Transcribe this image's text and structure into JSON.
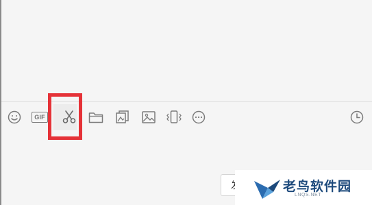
{
  "toolbar": {
    "items": [
      {
        "name": "emoji",
        "icon": "smiley-icon"
      },
      {
        "name": "gif",
        "icon": "gif-icon",
        "label": "GIF"
      },
      {
        "name": "screenshot",
        "icon": "scissors-icon",
        "highlighted": true
      },
      {
        "name": "file",
        "icon": "folder-icon"
      },
      {
        "name": "favorites",
        "icon": "album-icon"
      },
      {
        "name": "image",
        "icon": "image-icon"
      },
      {
        "name": "vibrate",
        "icon": "phone-shake-icon"
      },
      {
        "name": "more",
        "icon": "more-dots-icon"
      },
      {
        "name": "history",
        "icon": "clock-icon"
      }
    ]
  },
  "send": {
    "label": "发"
  },
  "watermark": {
    "title": "老鸟软件园",
    "subtitle": "LNQS.NET"
  },
  "colors": {
    "highlight": "#e53238",
    "icon": "#7b7b7b",
    "brand": "#1d4a7c",
    "background": "#f5f5f5"
  }
}
